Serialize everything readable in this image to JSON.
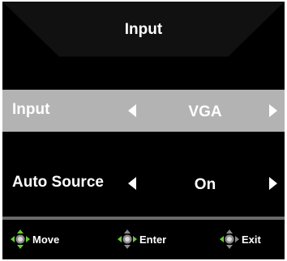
{
  "menu": {
    "title": "Input",
    "items": [
      {
        "label": "Input",
        "value": "VGA",
        "selected": true
      },
      {
        "label": "Auto Source",
        "value": "On",
        "selected": false
      }
    ]
  },
  "footer": {
    "move_label": "Move",
    "enter_label": "Enter",
    "exit_label": "Exit"
  },
  "colors": {
    "background": "#000000",
    "selected_row": "#b3b3b3",
    "text": "#ffffff",
    "divider": "#6a6a6a",
    "dpad_active": "#66cc33",
    "dpad_inactive": "#8a8a8a"
  },
  "icons": {
    "left_arrow": "arrow-left-icon",
    "right_arrow": "arrow-right-icon",
    "move": "dpad-move-icon",
    "enter": "dpad-enter-icon",
    "exit": "dpad-exit-icon"
  }
}
